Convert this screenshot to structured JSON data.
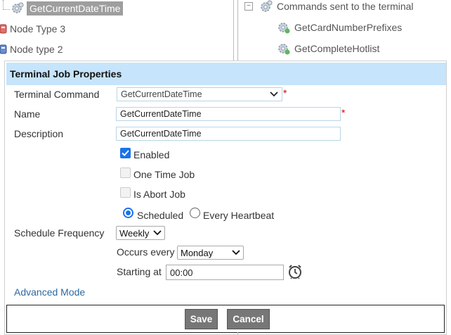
{
  "tree_left": {
    "selected_node": "GetCurrentDateTime",
    "items": [
      {
        "label": "Node Type 3"
      },
      {
        "label": "Node type 2"
      }
    ]
  },
  "tree_right": {
    "group_label": "Commands sent to the terminal",
    "items": [
      {
        "label": "GetCardNumberPrefixes"
      },
      {
        "label": "GetCompleteHotlist"
      }
    ]
  },
  "dialog": {
    "title": "Terminal Job Properties",
    "terminal_command": {
      "label": "Terminal Command",
      "value": "GetCurrentDateTime"
    },
    "name": {
      "label": "Name",
      "value": "GetCurrentDateTime"
    },
    "description": {
      "label": "Description",
      "value": "GetCurrentDateTime"
    },
    "required_marker": "*",
    "enabled": {
      "label": "Enabled",
      "checked": true
    },
    "one_time_job": {
      "label": "One Time Job",
      "checked": false
    },
    "is_abort_job": {
      "label": "Is Abort Job",
      "checked": false
    },
    "schedule_mode": {
      "scheduled_label": "Scheduled",
      "every_heartbeat_label": "Every Heartbeat",
      "selected": "Scheduled"
    },
    "schedule_frequency": {
      "label": "Schedule Frequency",
      "value": "Weekly"
    },
    "occurs_every": {
      "label": "Occurs every",
      "value": "Monday"
    },
    "starting_at": {
      "label": "Starting at",
      "value": "00:00"
    },
    "advanced_mode_link": "Advanced Mode",
    "buttons": {
      "save": "Save",
      "cancel": "Cancel"
    }
  },
  "colors": {
    "header_bg": "#c6e4fb",
    "link": "#2b6aa3",
    "button_bg": "#777777",
    "checkbox_accent": "#1a73e8",
    "required": "#dd0000"
  },
  "icons": [
    "gear-icon",
    "node-type-icon",
    "collapse-icon",
    "chevron-down-icon",
    "alarm-clock-icon"
  ]
}
